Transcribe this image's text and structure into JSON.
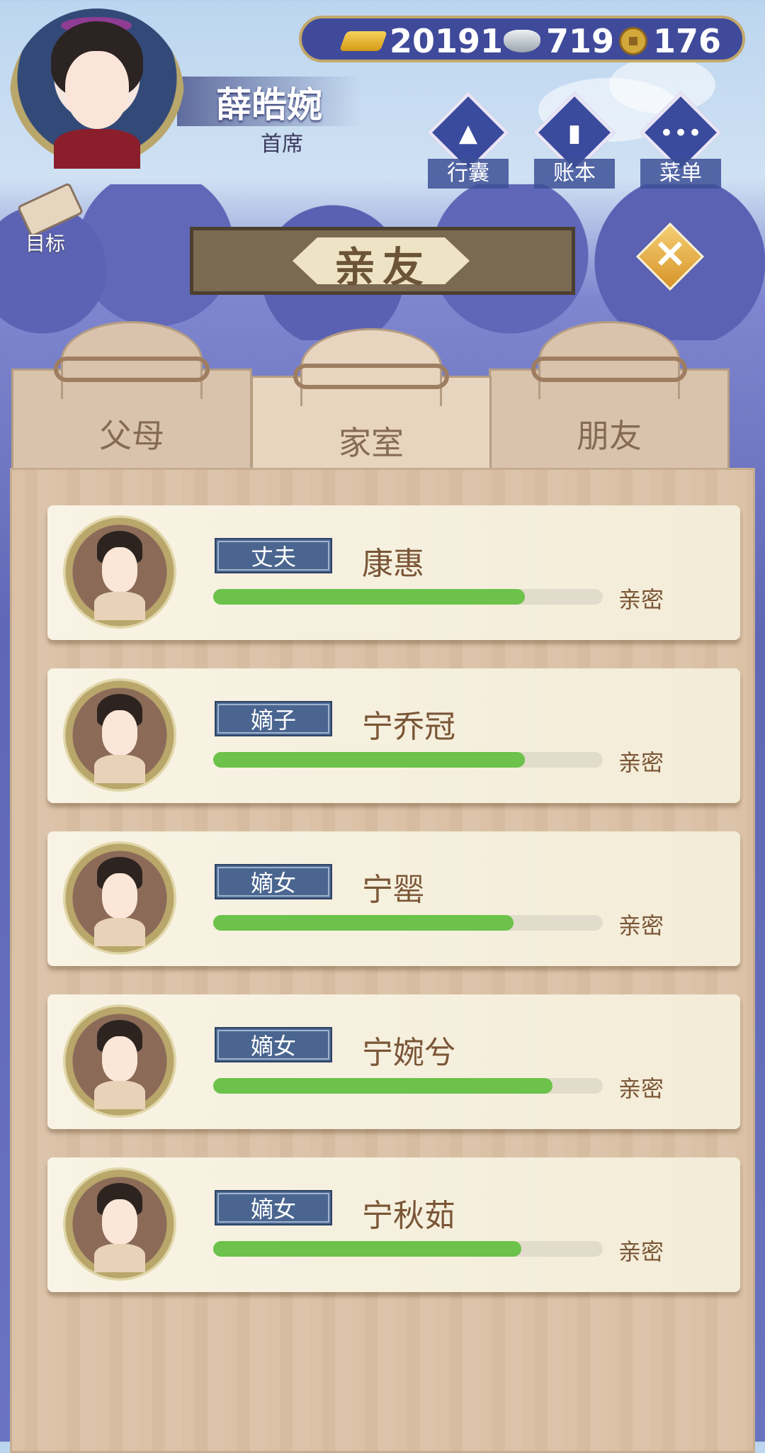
{
  "player": {
    "name": "薛皓婉",
    "rank": "首席"
  },
  "currency": {
    "gold": "20191",
    "silver": "719",
    "coins": "176"
  },
  "goal_label": "目标",
  "menu": [
    {
      "label": "行囊",
      "icon": "bag-icon"
    },
    {
      "label": "账本",
      "icon": "ledger-icon"
    },
    {
      "label": "菜单",
      "icon": "more-icon"
    }
  ],
  "title": "亲友",
  "tabs": [
    {
      "label": "父母",
      "active": false
    },
    {
      "label": "家室",
      "active": true
    },
    {
      "label": "朋友",
      "active": false
    }
  ],
  "members": [
    {
      "role": "丈夫",
      "name": "康惠",
      "relation": "亲密",
      "affinity": 0.8
    },
    {
      "role": "嫡子",
      "name": "宁乔冠",
      "relation": "亲密",
      "affinity": 0.8
    },
    {
      "role": "嫡女",
      "name": "宁罂",
      "relation": "亲密",
      "affinity": 0.77
    },
    {
      "role": "嫡女",
      "name": "宁婉兮",
      "relation": "亲密",
      "affinity": 0.87
    },
    {
      "role": "嫡女",
      "name": "宁秋茹",
      "relation": "亲密",
      "affinity": 0.79
    }
  ],
  "colors": {
    "affinity_bar": "#6cc24a",
    "role_badge": "#4a6690",
    "name_text": "#7a5636"
  }
}
